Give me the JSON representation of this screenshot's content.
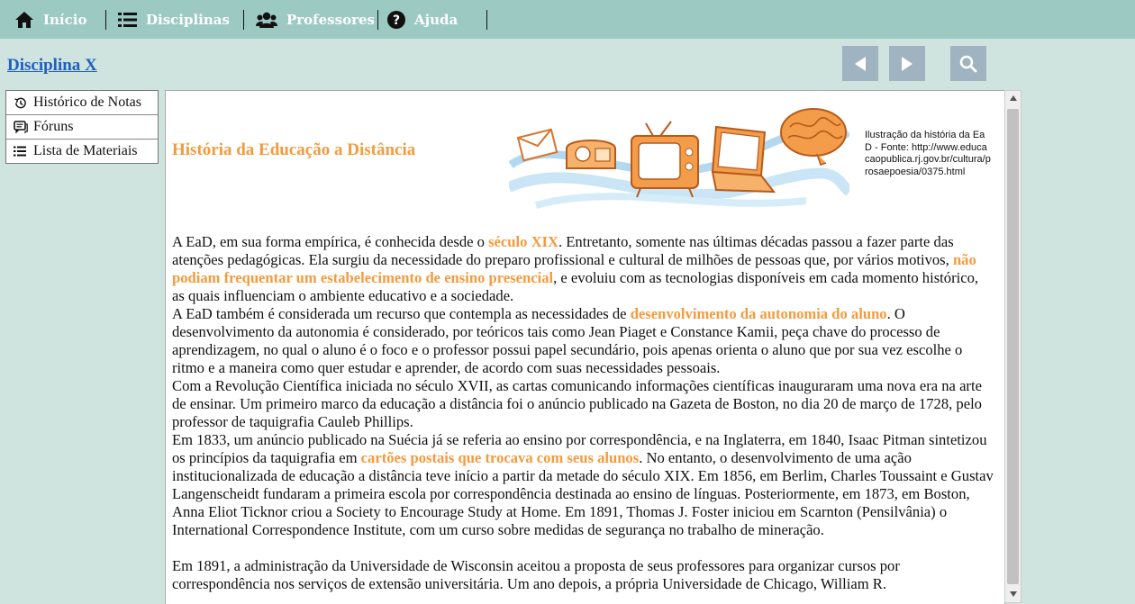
{
  "nav": {
    "items": [
      {
        "label": "Início",
        "icon": "home-icon"
      },
      {
        "label": "Disciplinas",
        "icon": "list-icon"
      },
      {
        "label": "Professores",
        "icon": "users-icon"
      },
      {
        "label": "Ajuda",
        "icon": "help-circle-icon"
      }
    ]
  },
  "course": {
    "title": "Disciplina X"
  },
  "controls": {
    "prev": "previous-icon",
    "next": "next-icon",
    "search": "search-icon"
  },
  "sidebar": {
    "items": [
      {
        "label": "Histórico de Notas",
        "icon": "history-icon"
      },
      {
        "label": "Fóruns",
        "icon": "chat-icon"
      },
      {
        "label": "Lista de Materiais",
        "icon": "list-icon"
      }
    ]
  },
  "content": {
    "title": "História da Educação a Distância",
    "caption": "Ilustração da história da EaD - Fonte: http://www.educacaopublica.rj.gov.br/cultura/prosaepoesia/0375.html",
    "p1": {
      "a": "A EaD, em sua forma empírica, é conhecida desde o ",
      "b": "século XIX",
      "c": ". Entretanto, somente nas últimas décadas passou a fazer parte das atenções pedagógicas. Ela surgiu da necessidade do preparo profissional e cultural de milhões de pessoas que, por vários motivos, ",
      "d": "não podiam frequentar um estabelecimento de ensino presencial",
      "e": ", e evoluiu com as tecnologias disponíveis em cada momento histórico, as quais influenciam o ambiente educativo e a sociedade."
    },
    "p2": {
      "a": "A EaD também é considerada um recurso que contempla as necessidades de ",
      "b": "desenvolvimento da autonomia do aluno",
      "c": ". O desenvolvimento da autonomia é considerado, por teóricos tais como Jean Piaget e Constance Kamii, peça chave do processo de aprendizagem, no qual o aluno é o foco e o professor possui papel secundário, pois apenas orienta o aluno que por sua vez escolhe o ritmo e a maneira como quer estudar e aprender, de acordo com suas necessidades pessoais."
    },
    "p3": "Com a Revolução Científica iniciada no século XVII, as cartas comunicando informações científicas inauguraram uma nova era na arte de ensinar. Um primeiro marco da educação a distância foi o anúncio publicado na Gazeta de Boston, no dia 20 de março de 1728, pelo professor de taquigrafia Cauleb Phillips.",
    "p4": {
      "a": "Em 1833, um anúncio publicado na Suécia já se referia ao ensino por correspondência, e na Inglaterra, em 1840, Isaac Pitman sintetizou os princípios da taquigrafia em ",
      "b": "cartões postais que trocava com seus alunos",
      "c": ". No entanto, o desenvolvimento de uma ação institucionalizada de educação a distância teve início a partir da metade do século XIX. Em 1856, em Berlim, Charles Toussaint e Gustav Langenscheidt fundaram a primeira escola por correspondência destinada ao ensino de línguas. Posteriormente, em 1873, em Boston, Anna Eliot Ticknor criou a Society to Encourage Study at Home. Em 1891, Thomas J. Foster iniciou em Scarnton (Pensilvânia) o International Correspondence Institute, com um curso sobre medidas de segurança no trabalho de mineração."
    },
    "p5": "Em 1891, a administração da Universidade de Wisconsin aceitou a proposta de seus professores para organizar cursos por correspondência nos serviços de extensão universitária. Um ano depois, a própria Universidade de Chicago, William R."
  },
  "colors": {
    "nav_bg": "#9ccac3",
    "page_bg": "#cfe3df",
    "highlight": "#f59a3c",
    "link": "#1f5fc0",
    "button": "#9fb3c0"
  }
}
